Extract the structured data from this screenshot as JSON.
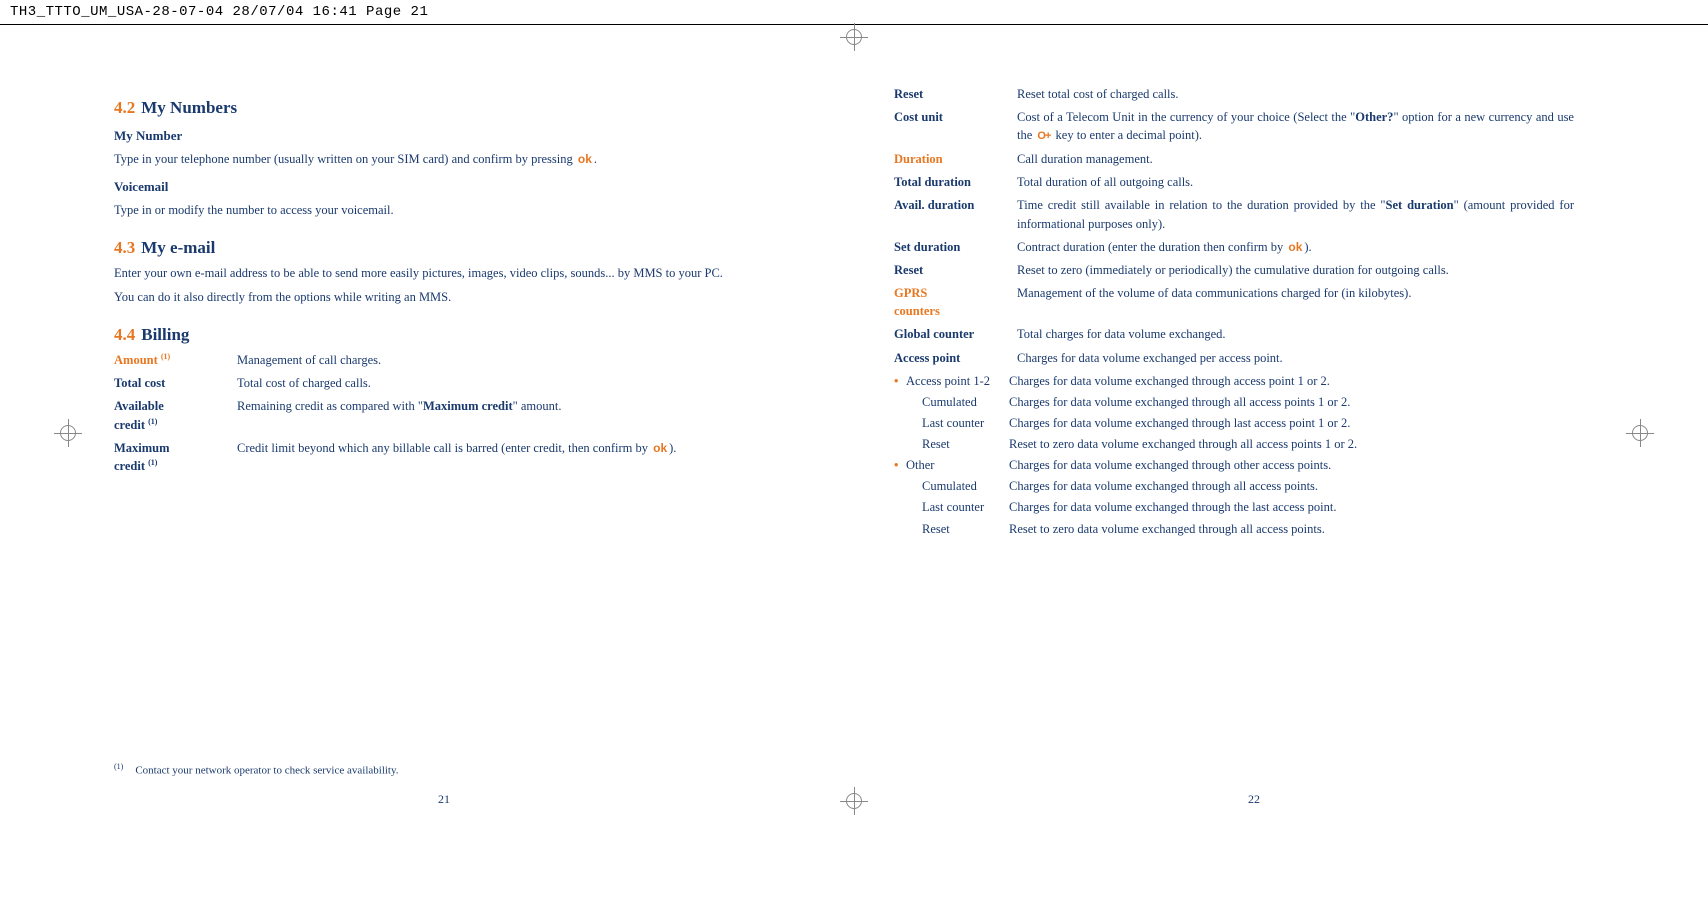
{
  "header": "TH3_TTTO_UM_USA-28-07-04  28/07/04  16:41  Page 21",
  "left": {
    "s42": {
      "num": "4.2",
      "title": "My Numbers"
    },
    "myNumber": {
      "heading": "My Number",
      "text_a": "Type in your telephone number (usually written on your SIM card) and confirm by pressing ",
      "text_b": "."
    },
    "voicemail": {
      "heading": "Voicemail",
      "text": "Type in or modify the number to access your voicemail."
    },
    "s43": {
      "num": "4.3",
      "title": "My e-mail"
    },
    "email_p1": "Enter your own e-mail address to be able to send more easily pictures, images, video clips, sounds... by MMS to your PC.",
    "email_p2": "You can do it also directly from the options while writing an MMS.",
    "s44": {
      "num": "4.4",
      "title": "Billing"
    },
    "billing": {
      "amount": {
        "term": "Amount ",
        "sup": "(1)",
        "desc": "Management of call charges."
      },
      "total": {
        "term": "Total cost",
        "desc": "Total cost of charged calls."
      },
      "avail": {
        "term1": "Available",
        "term2": "credit ",
        "sup": "(1)",
        "desc_a": "Remaining credit as compared with \"",
        "desc_bold": "Maximum credit",
        "desc_b": "\" amount."
      },
      "max": {
        "term1": "Maximum",
        "term2": "credit ",
        "sup": "(1)",
        "desc_a": "Credit limit beyond which any billable call is barred (enter credit, then confirm by ",
        "desc_b": ")."
      }
    },
    "footnote": {
      "mark": "(1)",
      "text": "Contact your network operator to check service availability."
    },
    "pageNum": "21"
  },
  "right": {
    "rows": {
      "reset1": {
        "term": "Reset",
        "desc": "Reset total cost of charged calls."
      },
      "costunit": {
        "term": "Cost unit",
        "desc_a": "Cost of a Telecom Unit in the currency of your choice (Select the \"",
        "desc_bold": "Other?",
        "desc_b": "\" option for a new currency and use the ",
        "desc_c": " key to enter a decimal point)."
      },
      "duration": {
        "term": "Duration",
        "desc": "Call duration management."
      },
      "totaldur": {
        "term": "Total duration",
        "desc": "Total duration of all outgoing calls."
      },
      "availdur": {
        "term": "Avail. duration",
        "desc_a": "Time credit still available in relation to the duration provided by the \"",
        "desc_bold": "Set duration",
        "desc_b": "\" (amount provided for informational purposes only)."
      },
      "setdur": {
        "term": "Set duration",
        "desc_a": "Contract duration (enter the duration then confirm by ",
        "desc_b": ")."
      },
      "reset2": {
        "term": "Reset",
        "desc": "Reset to zero (immediately or periodically) the cumulative duration for outgoing calls."
      },
      "gprs": {
        "term1": "GPRS",
        "term2": "counters",
        "desc": "Management of the volume of data communications charged for (in kilobytes)."
      },
      "global": {
        "term": "Global counter",
        "desc": "Total charges for data volume exchanged."
      },
      "access": {
        "term": "Access point",
        "desc": "Charges for data volume exchanged per access point."
      }
    },
    "ap12": {
      "head": {
        "term": "Access point 1-2",
        "desc": "Charges for data volume exchanged through access point 1 or 2."
      },
      "cum": {
        "term": "Cumulated",
        "desc": "Charges for data volume exchanged through all access points 1 or 2."
      },
      "last": {
        "term": "Last counter",
        "desc": "Charges for data volume exchanged through last access point 1 or 2."
      },
      "reset": {
        "term": "Reset",
        "desc": "Reset to zero data volume exchanged through all access points 1 or 2."
      }
    },
    "other": {
      "head": {
        "term": "Other",
        "desc": "Charges for data volume exchanged through other access points."
      },
      "cum": {
        "term": "Cumulated",
        "desc": "Charges for data volume exchanged through all access points."
      },
      "last": {
        "term": "Last counter",
        "desc": "Charges for data volume exchanged through the last access point."
      },
      "reset": {
        "term": "Reset",
        "desc": "Reset to zero data volume exchanged through all access points."
      }
    },
    "pageNum": "22"
  },
  "icons": {
    "ok": "ok",
    "key": "O+"
  }
}
